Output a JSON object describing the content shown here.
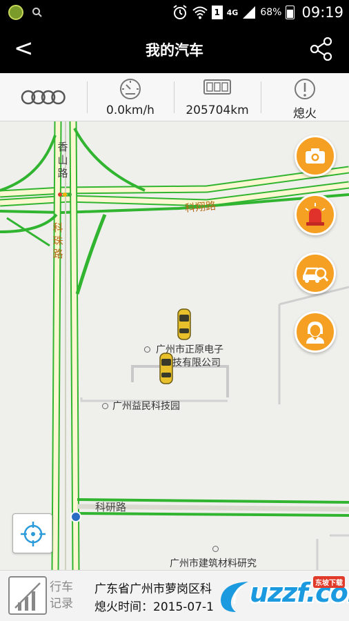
{
  "status_bar": {
    "network": "4G",
    "sim_slot": "1",
    "battery": "68%",
    "time": "09:19"
  },
  "header": {
    "back_label": "<",
    "title": "我的汽车"
  },
  "info_bar": {
    "brand_icon": "audi-rings-icon",
    "speed": "0.0km/h",
    "mileage": "205704km",
    "engine_status": "熄火"
  },
  "map": {
    "road_labels": {
      "xiangshan_road": [
        "香",
        "山",
        "路"
      ],
      "kexiang_road": "科翔路",
      "kezhu_road": [
        "科",
        "珠",
        "路"
      ],
      "keyan_road": "科研路"
    },
    "pois": {
      "zhengyuan": [
        "广州市正原电子",
        "技有限公司"
      ],
      "yimin": "广州益民科技园",
      "jianzhu": "广州市建筑材料研究"
    },
    "actions": [
      "camera-icon",
      "alarm-light-icon",
      "car-search-icon",
      "assistant-icon"
    ]
  },
  "bottom_bar": {
    "record_label": [
      "行车",
      "记录"
    ],
    "address": "广东省广州市萝岗区科",
    "engine_off_time": "熄火时间：2015-07-1",
    "watermark": "uzzf.com",
    "watermark_tag": "东坡下载"
  },
  "colors": {
    "header_bg": "#000000",
    "fab_orange": "#f5a023",
    "road_green": "#31b531",
    "road_fill": "#fbf7d0",
    "locate_blue": "#2a9ad8"
  }
}
